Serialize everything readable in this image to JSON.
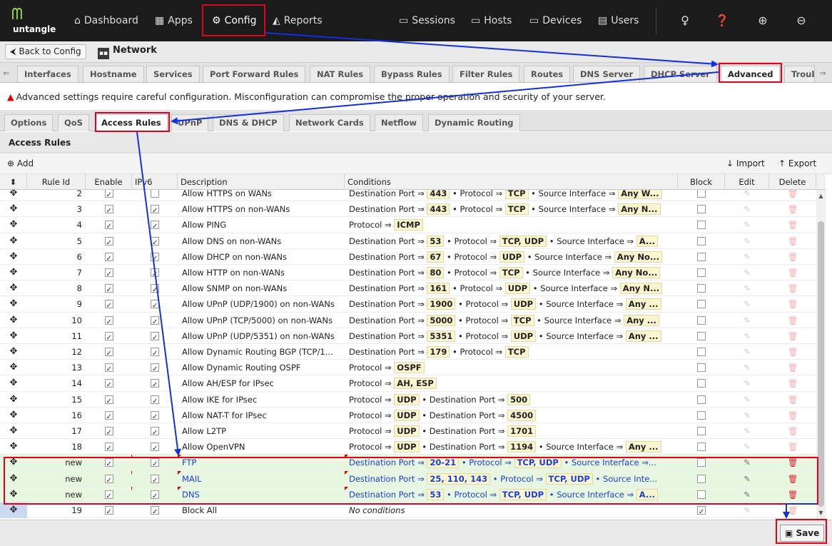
{
  "brand": {
    "name": "untangle"
  },
  "nav": {
    "dashboard": "Dashboard",
    "apps": "Apps",
    "config": "Config",
    "reports": "Reports",
    "sessions": "Sessions",
    "hosts": "Hosts",
    "devices": "Devices",
    "users": "Users"
  },
  "breadcrumb": {
    "back": "Back to Config",
    "title": "Network"
  },
  "tabs": [
    "Interfaces",
    "Hostname",
    "Services",
    "Port Forward Rules",
    "NAT Rules",
    "Bypass Rules",
    "Filter Rules",
    "Routes",
    "DNS Server",
    "DHCP Server",
    "Advanced",
    "Troub"
  ],
  "warning": "Advanced settings require careful configuration. Misconfiguration can compromise the proper operation and security of your server.",
  "subtabs": [
    "Options",
    "QoS",
    "Access Rules",
    "UPnP",
    "DNS & DHCP",
    "Network Cards",
    "Netflow",
    "Dynamic Routing"
  ],
  "panel": {
    "title": "Access Rules",
    "add": "Add",
    "import": "Import",
    "export": "Export"
  },
  "columns": {
    "rule_id": "Rule Id",
    "enable": "Enable",
    "ipv6": "IPv6",
    "description": "Description",
    "conditions": "Conditions",
    "block": "Block",
    "edit": "Edit",
    "delete": "Delete"
  },
  "rows": [
    {
      "id": "2",
      "enable": true,
      "ipv6": false,
      "desc": "Allow HTTPS on WANs",
      "cond": [
        [
          "Destination Port ⇒ ",
          "443"
        ],
        [
          " • Protocol ⇒ ",
          "TCP"
        ],
        [
          " • Source Interface ⇒ ",
          "Any W..."
        ]
      ],
      "block": false,
      "status": ""
    },
    {
      "id": "3",
      "enable": true,
      "ipv6": true,
      "desc": "Allow HTTPS on non-WANs",
      "cond": [
        [
          "Destination Port ⇒ ",
          "443"
        ],
        [
          " • Protocol ⇒ ",
          "TCP"
        ],
        [
          " • Source Interface ⇒ ",
          "Any N..."
        ]
      ],
      "block": false,
      "status": ""
    },
    {
      "id": "4",
      "enable": true,
      "ipv6": true,
      "desc": "Allow PING",
      "cond": [
        [
          "Protocol ⇒ ",
          "ICMP"
        ]
      ],
      "block": false,
      "status": ""
    },
    {
      "id": "5",
      "enable": true,
      "ipv6": true,
      "desc": "Allow DNS on non-WANs",
      "cond": [
        [
          "Destination Port ⇒ ",
          "53"
        ],
        [
          " • Protocol ⇒ ",
          "TCP, UDP"
        ],
        [
          " • Source Interface ⇒ ",
          "A..."
        ]
      ],
      "block": false,
      "status": ""
    },
    {
      "id": "6",
      "enable": true,
      "ipv6": true,
      "desc": "Allow DHCP on non-WANs",
      "cond": [
        [
          "Destination Port ⇒ ",
          "67"
        ],
        [
          " • Protocol ⇒ ",
          "UDP"
        ],
        [
          " • Source Interface ⇒ ",
          "Any No..."
        ]
      ],
      "block": false,
      "status": ""
    },
    {
      "id": "7",
      "enable": true,
      "ipv6": true,
      "desc": "Allow HTTP on non-WANs",
      "cond": [
        [
          "Destination Port ⇒ ",
          "80"
        ],
        [
          " • Protocol ⇒ ",
          "TCP"
        ],
        [
          " • Source Interface ⇒ ",
          "Any No..."
        ]
      ],
      "block": false,
      "status": ""
    },
    {
      "id": "8",
      "enable": true,
      "ipv6": true,
      "desc": "Allow SNMP on non-WANs",
      "cond": [
        [
          "Destination Port ⇒ ",
          "161"
        ],
        [
          " • Protocol ⇒ ",
          "UDP"
        ],
        [
          " • Source Interface ⇒ ",
          "Any N..."
        ]
      ],
      "block": false,
      "status": ""
    },
    {
      "id": "9",
      "enable": true,
      "ipv6": true,
      "desc": "Allow UPnP (UDP/1900) on non-WANs",
      "cond": [
        [
          "Destination Port ⇒ ",
          "1900"
        ],
        [
          " • Protocol ⇒ ",
          "UDP"
        ],
        [
          " • Source Interface ⇒ ",
          "Any ..."
        ]
      ],
      "block": false,
      "status": ""
    },
    {
      "id": "10",
      "enable": true,
      "ipv6": true,
      "desc": "Allow UPnP (TCP/5000) on non-WANs",
      "cond": [
        [
          "Destination Port ⇒ ",
          "5000"
        ],
        [
          " • Protocol ⇒ ",
          "TCP"
        ],
        [
          " • Source Interface ⇒ ",
          "Any ..."
        ]
      ],
      "block": false,
      "status": ""
    },
    {
      "id": "11",
      "enable": true,
      "ipv6": true,
      "desc": "Allow UPnP (UDP/5351) on non-WANs",
      "cond": [
        [
          "Destination Port ⇒ ",
          "5351"
        ],
        [
          " • Protocol ⇒ ",
          "UDP"
        ],
        [
          " • Source Interface ⇒ ",
          "Any ..."
        ]
      ],
      "block": false,
      "status": ""
    },
    {
      "id": "12",
      "enable": true,
      "ipv6": true,
      "desc": "Allow Dynamic Routing BGP (TCP/1...",
      "cond": [
        [
          "Destination Port ⇒ ",
          "179"
        ],
        [
          " • Protocol ⇒ ",
          "TCP"
        ]
      ],
      "block": false,
      "status": ""
    },
    {
      "id": "13",
      "enable": true,
      "ipv6": true,
      "desc": "Allow Dynamic Routing OSPF",
      "cond": [
        [
          "Protocol ⇒ ",
          "OSPF"
        ]
      ],
      "block": false,
      "status": ""
    },
    {
      "id": "14",
      "enable": true,
      "ipv6": true,
      "desc": "Allow AH/ESP for IPsec",
      "cond": [
        [
          "Protocol ⇒ ",
          "AH, ESP"
        ]
      ],
      "block": false,
      "status": ""
    },
    {
      "id": "15",
      "enable": true,
      "ipv6": true,
      "desc": "Allow IKE for IPsec",
      "cond": [
        [
          "Protocol ⇒ ",
          "UDP"
        ],
        [
          " • Destination Port ⇒ ",
          "500"
        ]
      ],
      "block": false,
      "status": ""
    },
    {
      "id": "16",
      "enable": true,
      "ipv6": true,
      "desc": "Allow NAT-T for IPsec",
      "cond": [
        [
          "Protocol ⇒ ",
          "UDP"
        ],
        [
          " • Destination Port ⇒ ",
          "4500"
        ]
      ],
      "block": false,
      "status": ""
    },
    {
      "id": "17",
      "enable": true,
      "ipv6": true,
      "desc": "Allow L2TP",
      "cond": [
        [
          "Protocol ⇒ ",
          "UDP"
        ],
        [
          " • Destination Port ⇒ ",
          "1701"
        ]
      ],
      "block": false,
      "status": ""
    },
    {
      "id": "18",
      "enable": true,
      "ipv6": true,
      "desc": "Allow OpenVPN",
      "cond": [
        [
          "Protocol ⇒ ",
          "UDP"
        ],
        [
          " • Destination Port ⇒ ",
          "1194"
        ],
        [
          " • Source Interface ⇒ ",
          "Any ..."
        ]
      ],
      "block": false,
      "status": ""
    },
    {
      "id": "new",
      "enable": true,
      "ipv6": true,
      "desc": "FTP",
      "cond": [
        [
          "Destination Port ⇒ ",
          "20-21"
        ],
        [
          " • Protocol ⇒ ",
          "TCP, UDP"
        ],
        [
          " • Source Interface ⇒...",
          ""
        ]
      ],
      "block": false,
      "status": "new"
    },
    {
      "id": "new",
      "enable": true,
      "ipv6": true,
      "desc": "MAIL",
      "cond": [
        [
          "Destination Port ⇒ ",
          "25, 110, 143"
        ],
        [
          " • Protocol ⇒ ",
          "TCP, UDP"
        ],
        [
          " • Source Inte...",
          ""
        ]
      ],
      "block": false,
      "status": "new"
    },
    {
      "id": "new",
      "enable": true,
      "ipv6": true,
      "desc": "DNS",
      "cond": [
        [
          "Destination Port ⇒ ",
          "53"
        ],
        [
          " • Protocol ⇒ ",
          "TCP, UDP"
        ],
        [
          " • Source Interface ⇒ ",
          "A..."
        ]
      ],
      "block": false,
      "status": "new"
    },
    {
      "id": "19",
      "enable": true,
      "ipv6": true,
      "desc": "Block All",
      "cond_text": "No conditions",
      "block": true,
      "status": ""
    }
  ],
  "footer": {
    "save": "Save"
  },
  "colors": {
    "highlight": "#e3001b",
    "arrow": "#1230e0",
    "new_row": "#e8f7e0"
  }
}
